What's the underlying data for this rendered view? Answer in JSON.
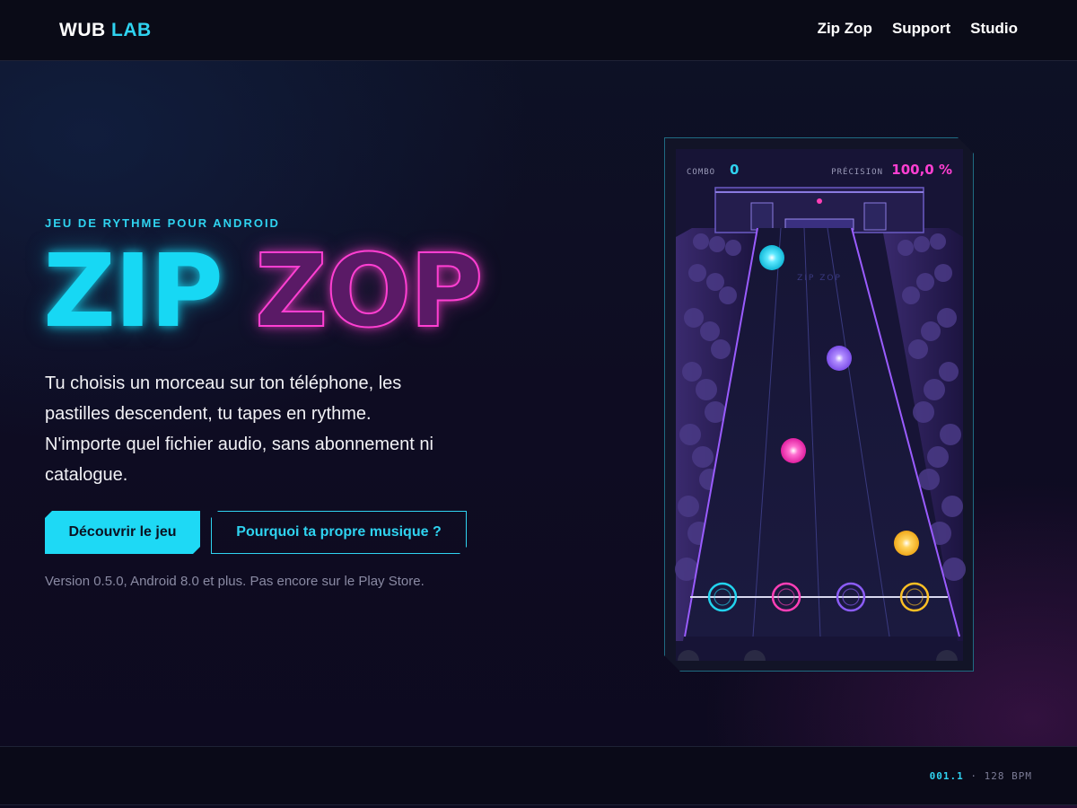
{
  "header": {
    "logo_word1": "WUB",
    "logo_word2": "LAB",
    "nav": [
      "Zip Zop",
      "Support",
      "Studio"
    ]
  },
  "hero": {
    "kicker": "JEU DE RYTHME POUR ANDROID",
    "title_part1": "ZIP",
    "title_part2": "ZOP",
    "lead": "Tu choisis un morceau sur ton téléphone, les pastilles descendent, tu tapes en rythme. N'importe quel fichier audio, sans abonnement ni catalogue.",
    "primary_button": "Découvrir le jeu",
    "secondary_button": "Pourquoi ta propre musique ?",
    "version_note": "Version 0.5.0, Android 8.0 et plus. Pas encore sur le Play Store."
  },
  "game": {
    "combo_label": "COMBO",
    "combo_value": "0",
    "precision_label": "PRÉCISION",
    "precision_value": "100,0 %",
    "stage_sign": "ZIP ZOP",
    "lane_colors": [
      "#22d3ee",
      "#ff3fb6",
      "#8b5cf6",
      "#fbbf24"
    ]
  },
  "footer": {
    "version": "001.1",
    "separator": "·",
    "bpm": "128 BPM"
  },
  "colors": {
    "accent_cyan": "#2fd3f0",
    "accent_pink": "#ff3fd2",
    "background": "#0b0a1a"
  }
}
